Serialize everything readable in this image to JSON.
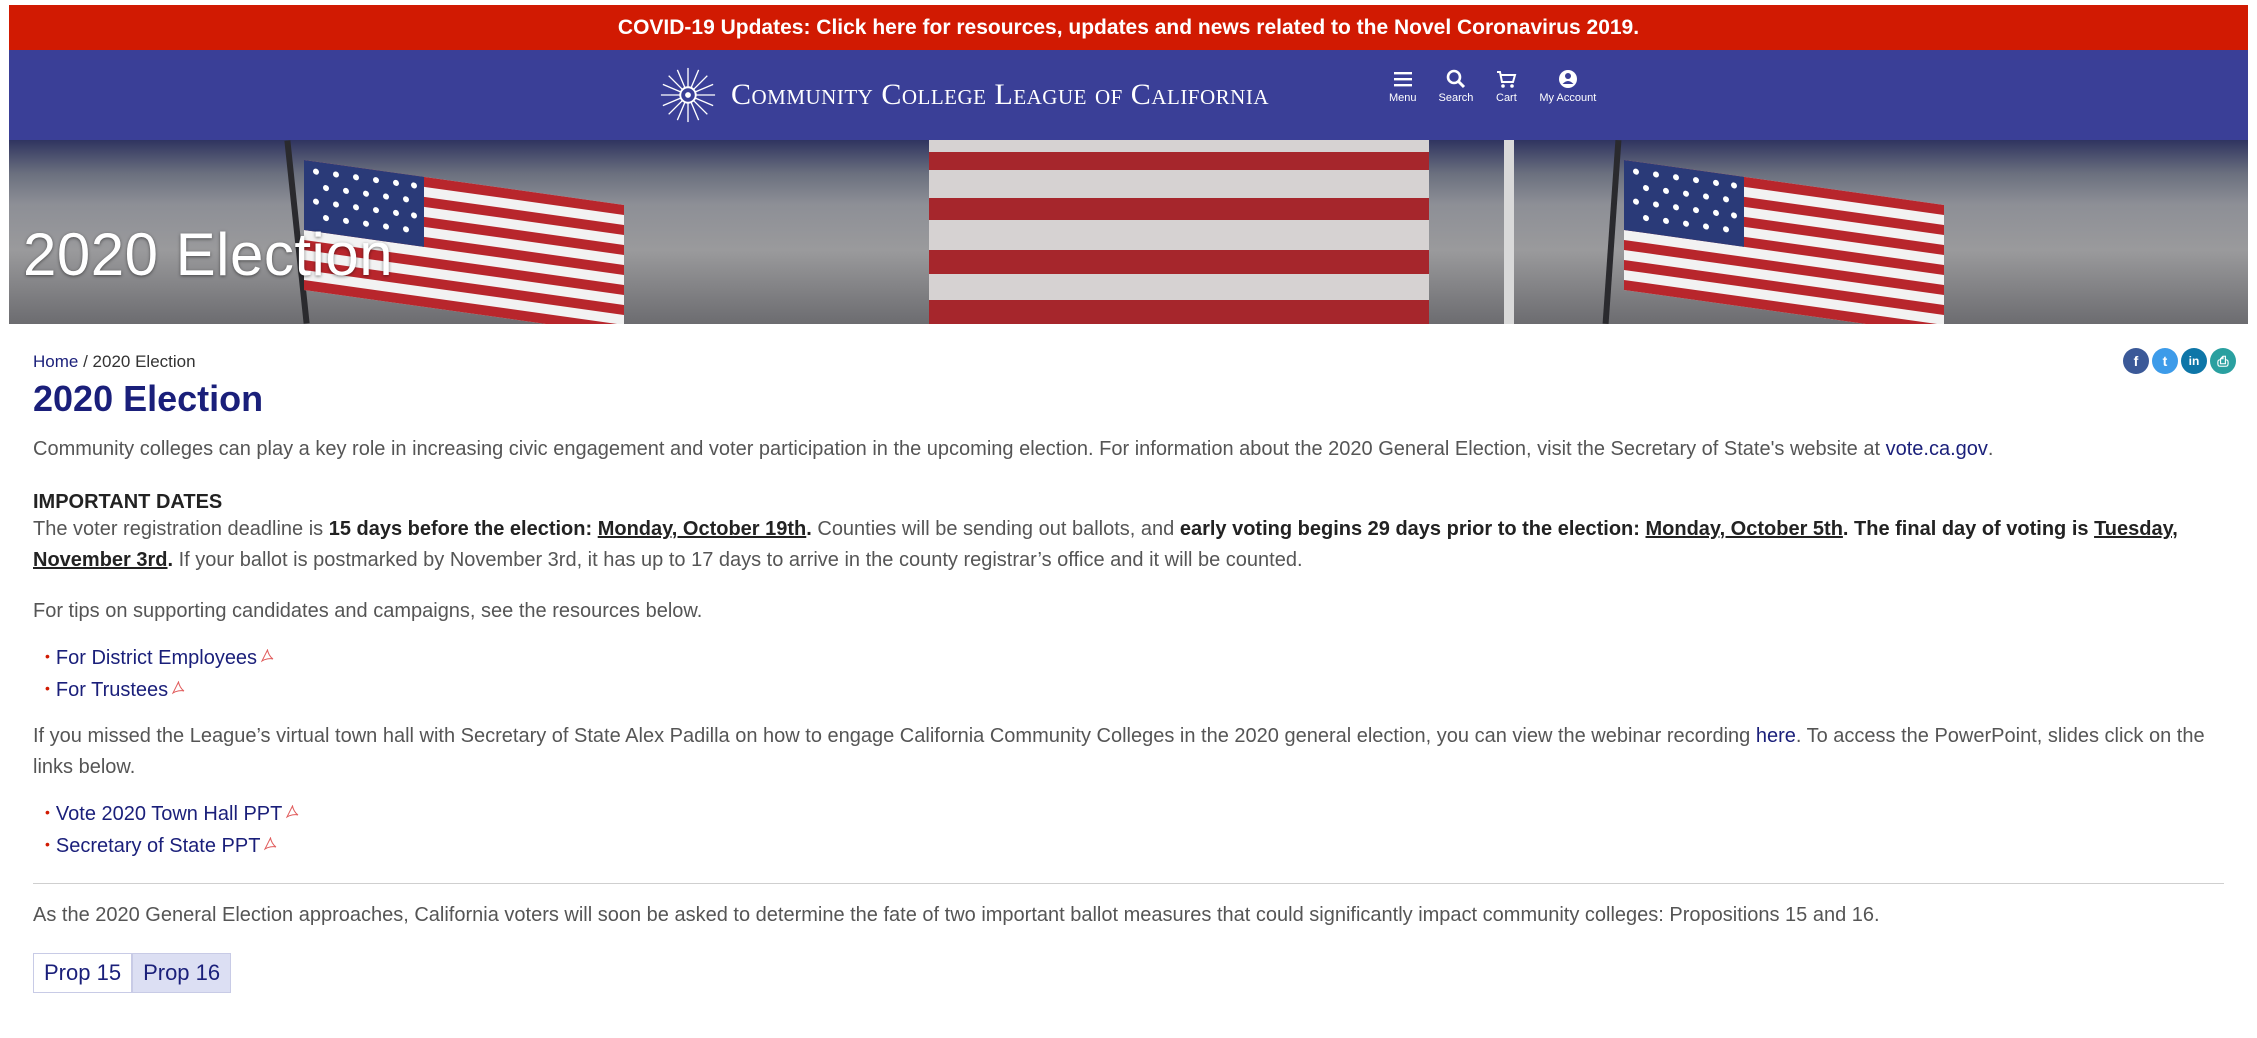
{
  "banner": {
    "text": "COVID-19 Updates: Click here for resources, updates and news related to the Novel Coronavirus 2019."
  },
  "header": {
    "brand": "Community College League of California",
    "nav": [
      {
        "label": "Menu",
        "icon": "menu-icon"
      },
      {
        "label": "Search",
        "icon": "search-icon"
      },
      {
        "label": "Cart",
        "icon": "cart-icon"
      },
      {
        "label": "My Account",
        "icon": "account-icon"
      }
    ]
  },
  "hero": {
    "title": "2020 Election"
  },
  "breadcrumb": {
    "home": "Home",
    "separator": " / ",
    "current": "2020 Election"
  },
  "share": [
    "facebook-icon",
    "twitter-icon",
    "linkedin-icon",
    "print-icon"
  ],
  "page": {
    "title": "2020 Election",
    "intro_text": "Community colleges can play a key role in increasing civic engagement and voter participation in the upcoming election. For information about the 2020 General Election, visit the Secretary of State's website at ",
    "intro_link": "vote.ca.gov",
    "intro_end": ".",
    "dates_heading": "IMPORTANT DATES",
    "dates": {
      "t1": "The voter registration deadline is ",
      "b1": "15 days before the election: ",
      "u1": "Monday, October 19th",
      "b1end": ".",
      "t2": " Counties will be sending out ballots, and ",
      "b2": "early voting begins 29 days prior to the election: ",
      "u2": "Monday, October 5th",
      "b3": ". The final day of voting is ",
      "u3": "Tuesday, November 3rd",
      "b3end": ".",
      "t3": " If your ballot is postmarked by November 3rd, it has up to 17 days to arrive in the county registrar’s office and it will be counted."
    },
    "tips": "For tips on supporting candidates and campaigns, see the resources below.",
    "docs1": [
      "For District Employees",
      "For Trustees"
    ],
    "townhall_text": "If you missed the League’s virtual town hall with Secretary of State Alex Padilla on how to engage California Community Colleges in the 2020 general election, you can view the webinar recording ",
    "townhall_link": "here",
    "townhall_end": ". To access the PowerPoint, slides click on the links below.",
    "docs2": [
      "Vote 2020 Town Hall PPT",
      "Secretary of State PPT"
    ],
    "props_text": "As the 2020 General Election approaches, California voters will soon be asked to determine the fate of two important ballot measures that could significantly impact community colleges: Propositions 15 and 16.",
    "tabs": [
      "Prop 15",
      "Prop 16"
    ],
    "active_tab": "Prop 16"
  },
  "colors": {
    "banner": "#d11a02",
    "header": "#3a3f97",
    "link": "#1a1f7a"
  }
}
